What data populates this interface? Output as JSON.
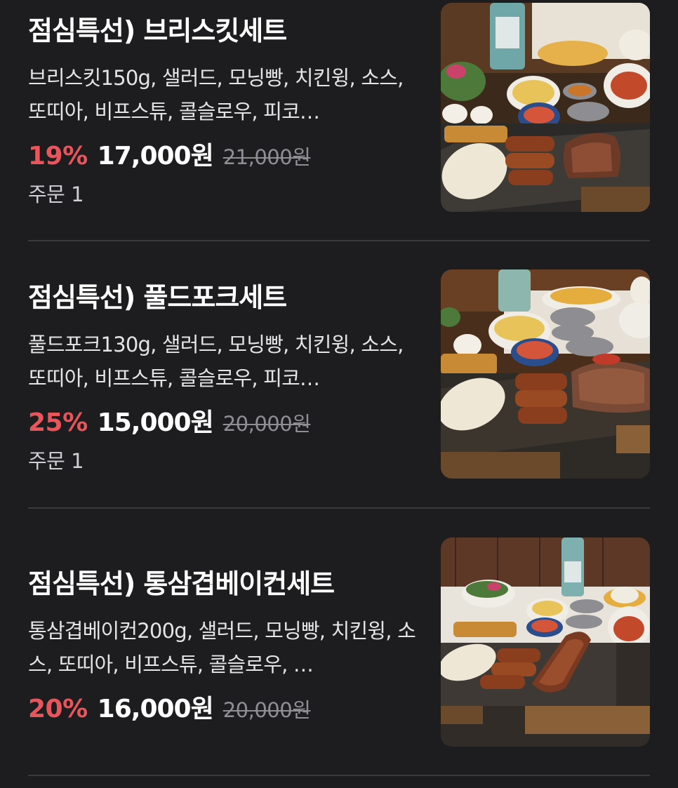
{
  "menu": {
    "items": [
      {
        "name": "점심특선) 브리스킷세트",
        "description": "브리스킷150g, 샐러드, 모닝빵, 치킨윙, 소스, 또띠아, 비프스튜, 콜슬로우, 피코…",
        "discount": "19%",
        "price": "17,000원",
        "original_price": "21,000원",
        "order_count": "주문 1",
        "image_icon": "brisket-set-photo"
      },
      {
        "name": "점심특선) 풀드포크세트",
        "description": "풀드포크130g, 샐러드, 모닝빵, 치킨윙, 소스, 또띠아, 비프스튜, 콜슬로우, 피코…",
        "discount": "25%",
        "price": "15,000원",
        "original_price": "20,000원",
        "order_count": "주문 1",
        "image_icon": "pulled-pork-set-photo"
      },
      {
        "name": "점심특선) 통삼겹베이컨세트",
        "description": "통삼겹베이컨200g, 샐러드, 모닝빵, 치킨윙, 소스, 또띠아, 비프스튜, 콜슬로우, …",
        "discount": "20%",
        "price": "16,000원",
        "original_price": "20,000원",
        "image_icon": "pork-belly-bacon-set-photo"
      }
    ]
  },
  "colors": {
    "background": "#1d1d1f",
    "discount": "#e8565b",
    "divider": "#3a3a3d",
    "strikethrough_text": "#8e8e93"
  }
}
